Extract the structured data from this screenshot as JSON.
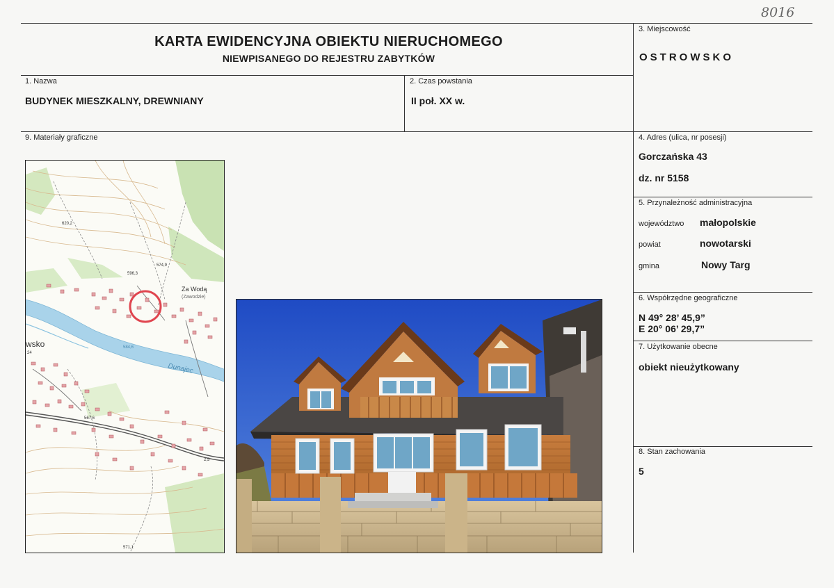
{
  "handwritten_number": "8016",
  "header": {
    "title": "KARTA EWIDENCYJNA OBIEKTU NIERUCHOMEGO",
    "subtitle": "NIEWPISANEGO DO REJESTRU ZABYTKÓW"
  },
  "fields": {
    "nazwa": {
      "label": "1. Nazwa",
      "value": "BUDYNEK MIESZKALNY, DREWNIANY"
    },
    "czas": {
      "label": "2. Czas powstania",
      "value": "II poł. XX w."
    },
    "miejscowosc": {
      "label": "3. Miejscowość",
      "value": "OSTROWSKO"
    },
    "adres": {
      "label": "4. Adres (ulica, nr posesji)",
      "street": "Gorczańska 43",
      "plot": "dz. nr 5158"
    },
    "przynaleznosc": {
      "label": "5. Przynależność administracyjna",
      "rows": [
        {
          "key": "województwo",
          "value": "małopolskie"
        },
        {
          "key": "powiat",
          "value": "nowotarski"
        },
        {
          "key": "gmina",
          "value": "Nowy Targ"
        }
      ]
    },
    "wspolrzedne": {
      "label": "6. Współrzędne geograficzne",
      "lat": "N 49° 28’ 45,9”",
      "lon": "E 20° 06’ 29,7”"
    },
    "uzytkowanie": {
      "label": "7. Użytkowanie obecne",
      "value": "obiekt nieużytkowany"
    },
    "stan": {
      "label": "8. Stan zachowania",
      "value": "5"
    },
    "materialy": {
      "label": "9. Materiały graficzne"
    }
  },
  "map": {
    "labels": {
      "place1": "Za Wodą",
      "place2": "(Zawodzie)",
      "river": "Dunajec",
      "village": "wsko",
      "h1": "620,2",
      "h2": "596,3",
      "h3": "574,9",
      "h4": "584,6",
      "h5": "567,6",
      "h6": "571,1",
      "h7": "2,5",
      "h8": "24"
    }
  }
}
